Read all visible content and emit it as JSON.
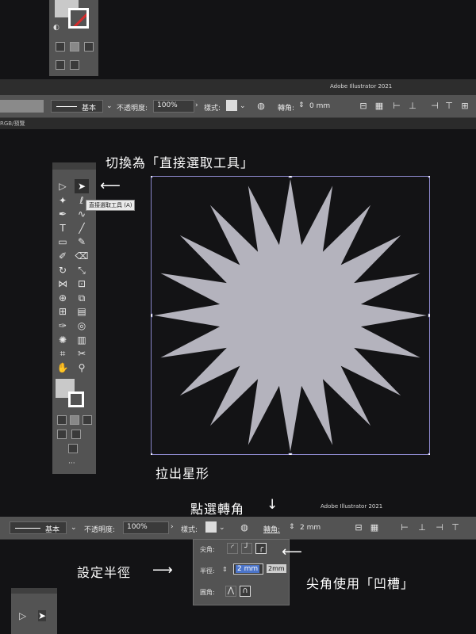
{
  "app_title": "Adobe Illustrator 2021",
  "control_bar": {
    "stroke_style_label": "基本",
    "opacity_label": "不透明度:",
    "opacity_value": "100%",
    "style_label": "樣式:",
    "corner_label": "轉角:",
    "corner_value_top": "0 mm",
    "corner_value_bottom": "2 mm"
  },
  "doc_tab": "RGB/預覽",
  "toolbox": {
    "tooltip": "直接選取工具 (A)",
    "tools": [
      "selection-tool",
      "direct-selection-tool",
      "magic-wand-tool",
      "lasso-tool",
      "pen-tool",
      "curvature-tool",
      "type-tool",
      "line-tool",
      "rectangle-tool",
      "paintbrush-tool",
      "shaper-tool",
      "eraser-tool",
      "rotate-tool",
      "scale-tool",
      "width-tool",
      "free-transform-tool",
      "shape-builder-tool",
      "perspective-tool",
      "mesh-tool",
      "gradient-tool",
      "eyedropper-tool",
      "blend-tool",
      "symbol-sprayer-tool",
      "column-graph-tool",
      "artboard-tool",
      "slice-tool",
      "hand-tool",
      "zoom-tool"
    ],
    "more": "···"
  },
  "annotations": {
    "switch_tool": "切換為「直接選取工具」",
    "arrow_left": "⟵",
    "draw_star": "拉出星形",
    "click_corner": "點選轉角",
    "arrow_down": "↓",
    "set_radius": "設定半徑",
    "arrow_right": "⟶",
    "use_notch": "尖角使用「凹槽」",
    "arrow_left2": "⟵"
  },
  "corner_popover": {
    "corner_label": "尖角:",
    "radius_label": "半徑:",
    "radius_value": "2 mm",
    "radius_hint": "2mm",
    "rounding_label": "圓角:"
  },
  "colors": {
    "ui_panel": "#535353",
    "background": "#131315",
    "star_fill": "#b4b3bd",
    "selection": "#8a86c9"
  },
  "star": {
    "points": 20
  }
}
